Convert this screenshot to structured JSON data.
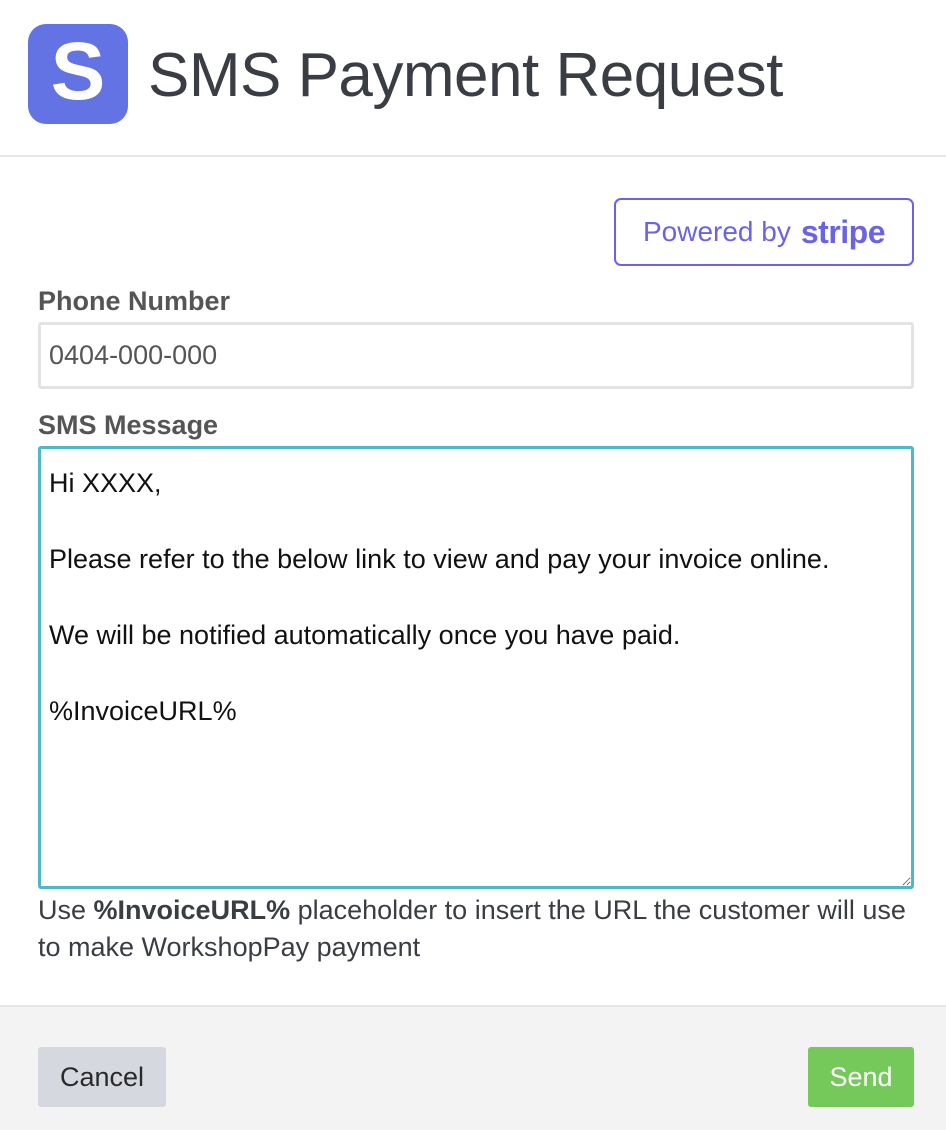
{
  "header": {
    "logo_letter": "S",
    "title": "SMS Payment Request"
  },
  "powered_by": {
    "prefix": "Powered by",
    "brand": "stripe",
    "color": "#6a63e6"
  },
  "form": {
    "phone": {
      "label": "Phone Number",
      "value": "0404-000-000"
    },
    "sms": {
      "label": "SMS Message",
      "value": "Hi XXXX,\n\nPlease refer to the below link to view and pay your invoice online.\n\nWe will be notified automatically once you have paid.\n\n%InvoiceURL%"
    },
    "help": {
      "prefix": "Use ",
      "placeholder_token": "%InvoiceURL%",
      "suffix": " placeholder to insert the URL the customer will use to make WorkshopPay payment"
    }
  },
  "footer": {
    "cancel_label": "Cancel",
    "send_label": "Send"
  },
  "colors": {
    "logo_bg": "#6473e3",
    "focus_border": "#4fb8c8",
    "send_bg": "#74c95a",
    "cancel_bg": "#d5d8df"
  }
}
